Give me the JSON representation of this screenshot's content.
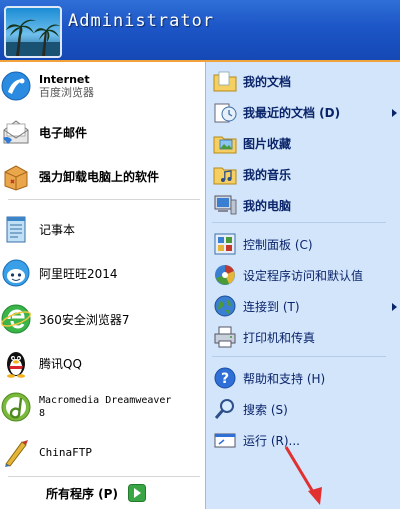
{
  "header": {
    "user_name": "Administrator"
  },
  "left_pinned": [
    {
      "name": "internet",
      "line1": "Internet",
      "line2": "百度浏览器"
    },
    {
      "name": "email",
      "label": "电子邮件"
    },
    {
      "name": "uninstall",
      "label": "强力卸载电脑上的软件"
    }
  ],
  "left_recent": [
    {
      "name": "notepad",
      "label": "记事本"
    },
    {
      "name": "aliwangwang",
      "label": "阿里旺旺2014"
    },
    {
      "name": "360-browser",
      "label": "360安全浏览器7"
    },
    {
      "name": "tencent-qq",
      "label": "腾讯QQ"
    },
    {
      "name": "dreamweaver",
      "line1": "Macromedia Dreamweaver",
      "line2": "8"
    },
    {
      "name": "chinaftp",
      "label": "ChinaFTP"
    }
  ],
  "all_programs": {
    "label": "所有程序 (P)"
  },
  "right": {
    "my_documents": "我的文档",
    "recent_documents": "我最近的文档 (D)",
    "my_pictures": "图片收藏",
    "my_music": "我的音乐",
    "my_computer": "我的电脑",
    "control_panel": "控制面板 (C)",
    "set_program_access": "设定程序访问和默认值",
    "connect_to": "连接到 (T)",
    "printers": "打印机和传真",
    "help": "帮助和支持 (H)",
    "search": "搜索 (S)",
    "run": "运行 (R)..."
  },
  "colors": {
    "header_blue": "#1d56c7",
    "right_panel": "#d3e5fa",
    "accent_orange": "#f2a23b",
    "annotation_red": "#e03030"
  }
}
